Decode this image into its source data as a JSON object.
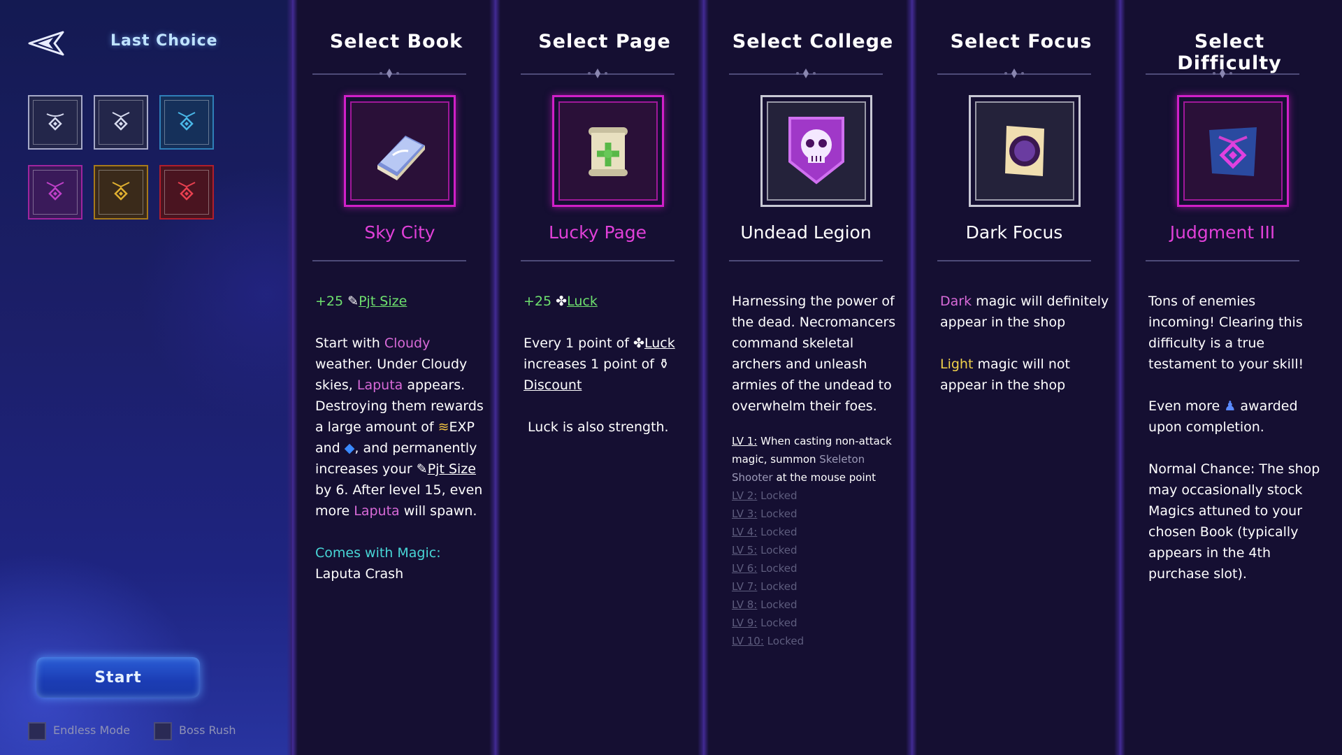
{
  "sidebar": {
    "back_icon": "back-arrow-icon",
    "last_choice_label": "Last Choice",
    "slots": [
      {
        "icon": "rune-diamond-icon",
        "color": "#a6a9c8"
      },
      {
        "icon": "rune-diamond-icon",
        "color": "#a6a9c8"
      },
      {
        "icon": "rune-diamond-icon",
        "color": "#3aa0d8"
      },
      {
        "icon": "rune-diamond-icon",
        "color": "#c030c0"
      },
      {
        "icon": "rune-diamond-icon",
        "color": "#d4a020"
      },
      {
        "icon": "rune-diamond-icon",
        "color": "#d02a3a"
      }
    ],
    "start_label": "Start",
    "endless_mode_label": "Endless Mode",
    "boss_rush_label": "Boss Rush"
  },
  "columns": {
    "book": {
      "title": "Select Book",
      "name": "Sky City",
      "icon": "spellbook-icon",
      "frame_color": "#d020c8",
      "bonus_value": "+25",
      "bonus_stat": "Pjt Size",
      "desc_1": "Start with",
      "desc_cloudy": "Cloudy",
      "desc_2": "weather. Under Cloudy skies,",
      "desc_laputa": "Laputa",
      "desc_3": "appears. Destroying them rewards a large amount of",
      "desc_exp": "EXP and",
      "desc_4": ", and permanently increases your",
      "desc_pjt": "Pjt Size",
      "desc_5": "by 6. After level 15, even more",
      "desc_laputa2": "Laputa",
      "desc_6": "will spawn.",
      "comes_with_label": "Comes with Magic:",
      "comes_with_value": "Laputa Crash"
    },
    "page": {
      "title": "Select Page",
      "name": "Lucky Page",
      "icon": "clover-scroll-icon",
      "frame_color": "#d020c8",
      "bonus_value": "+25",
      "bonus_stat": "Luck",
      "desc_1": "Every 1 point of",
      "desc_luck": "Luck",
      "desc_2": "increases 1 point of",
      "desc_discount": "Discount",
      "desc_3": "Luck is also strength."
    },
    "college": {
      "title": "Select College",
      "name": "Undead Legion",
      "icon": "skull-shield-icon",
      "frame_color": "#b8b8c8",
      "desc": "Harnessing the power of the dead. Necromancers command skeletal archers and unleash armies of the undead to overwhelm their foes.",
      "lv1_label": "LV 1:",
      "lv1_text_a": "When casting non-attack magic, summon",
      "lv1_skeleton": "Skeleton Shooter",
      "lv1_text_b": "at the mouse point",
      "locked_levels": [
        {
          "label": "LV 2:",
          "text": "Locked"
        },
        {
          "label": "LV 3:",
          "text": "Locked"
        },
        {
          "label": "LV 4:",
          "text": "Locked"
        },
        {
          "label": "LV 5:",
          "text": "Locked"
        },
        {
          "label": "LV 6:",
          "text": "Locked"
        },
        {
          "label": "LV 7:",
          "text": "Locked"
        },
        {
          "label": "LV 8:",
          "text": "Locked"
        },
        {
          "label": "LV 9:",
          "text": "Locked"
        },
        {
          "label": "LV 10:",
          "text": "Locked"
        }
      ]
    },
    "focus": {
      "title": "Select Focus",
      "name": "Dark Focus",
      "icon": "dark-orb-scroll-icon",
      "frame_color": "#b8b8c8",
      "desc_dark": "Dark",
      "desc_1": "magic will definitely appear in the shop",
      "desc_light": "Light",
      "desc_2": "magic will not appear in the shop"
    },
    "difficulty": {
      "title": "Select Difficulty",
      "name": "Judgment III",
      "icon": "judgment-rune-icon",
      "frame_color": "#d020c8",
      "desc_1": "Tons of enemies incoming! Clearing this difficulty is a true testament to your skill!",
      "desc_2a": "Even more",
      "desc_2b": "awarded upon completion.",
      "desc_3": "Normal Chance: The shop may occasionally stock Magics attuned to your chosen Book (typically appears in the 4th purchase slot)."
    }
  },
  "colors": {
    "accent_pink": "#e040d8",
    "accent_green": "#6ee06e",
    "accent_cyan": "#48d6d6",
    "accent_yellow": "#f0d24a"
  }
}
